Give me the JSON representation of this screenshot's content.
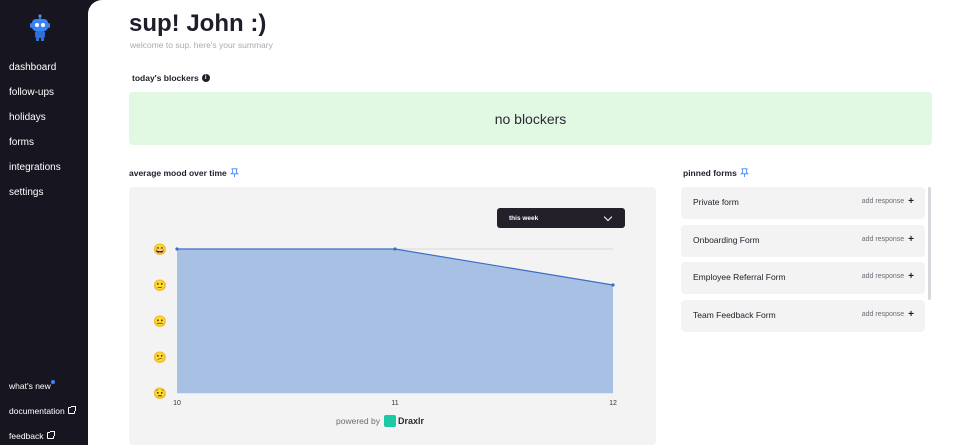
{
  "sidebar": {
    "nav": [
      "dashboard",
      "follow-ups",
      "holidays",
      "forms",
      "integrations",
      "settings"
    ],
    "bottom": {
      "whats_new": "what's new",
      "documentation": "documentation",
      "feedback": "feedback"
    }
  },
  "header": {
    "greeting": "sup! John :)",
    "subtitle": "welcome to sup. here's your summary"
  },
  "blockers": {
    "title": "today's blockers",
    "empty_text": "no blockers"
  },
  "mood": {
    "title": "average mood over time",
    "period_select": "this week",
    "powered_by": "powered by",
    "powered_brand": "Draxlr"
  },
  "chart_data": {
    "type": "area",
    "x": [
      "10",
      "11",
      "12"
    ],
    "values": [
      5,
      5,
      4
    ],
    "ylim": [
      1,
      5
    ],
    "y_ticks": [
      "😄",
      "🙂",
      "😐",
      "😕",
      "😟"
    ],
    "grid": true,
    "colors": {
      "fill": "#a7c0e4",
      "line": "#3b6fc4"
    }
  },
  "pinned": {
    "title": "pinned forms",
    "forms": [
      {
        "name": "Private form",
        "action": "add response"
      },
      {
        "name": "Onboarding Form",
        "action": "add response"
      },
      {
        "name": "Employee Referral Form",
        "action": "add response"
      },
      {
        "name": "Team Feedback Form",
        "action": "add response"
      }
    ]
  },
  "colors": {
    "sidebar_bg": "#17151f",
    "blockers_bg": "#e1f8e2",
    "card_bg": "#f3f3f3"
  }
}
